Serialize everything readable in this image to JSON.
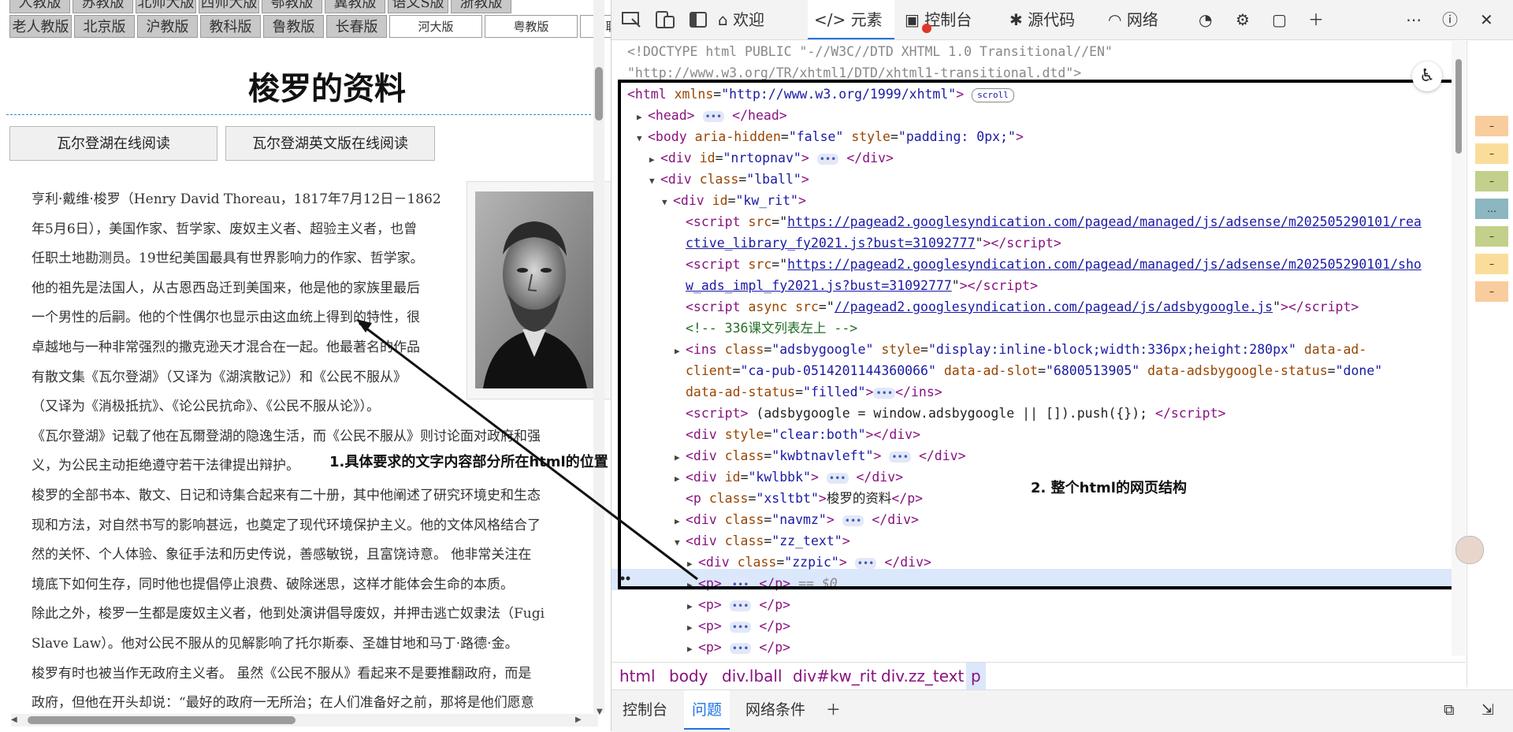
{
  "left_page": {
    "nav_row1": [
      "人教版",
      "苏教版",
      "北师大版",
      "西师大版",
      "鄂教版",
      "冀教版",
      "语文S版",
      "浙教版"
    ],
    "nav_row2": [
      "老人教版",
      "北京版",
      "沪教版",
      "教科版",
      "鲁教版",
      "长春版"
    ],
    "nav_row2_white": [
      "河大版",
      "粤教版",
      "中职版"
    ],
    "title": "梭罗的资料",
    "read_buttons": [
      "瓦尔登湖在线阅读",
      "瓦尔登湖英文版在线阅读"
    ],
    "article_lines": [
      "亨利·戴维·梭罗（Henry David Thoreau，1817年7月12日－1862",
      "年5月6日），美国作家、哲学家、废奴主义者、超验主义者，也曾",
      "任职土地勘测员。19世纪美国最具有世界影响力的作家、哲学家。",
      "他的祖先是法国人，从古恩西岛迁到美国来，他是他的家族里最后",
      "一个男性的后嗣。他的个性偶尔也显示由这血统上得到的特性，很",
      "卓越地与一种非常强烈的撒克逊天才混合在一起。他最著名的作品",
      "有散文集《瓦尔登湖》（又译为《湖滨散记》）和《公民不服从》",
      "（又译为《消极抵抗》、《论公民抗命》、《公民不服从论》）。",
      "《瓦尔登湖》记载了他在瓦爾登湖的隐逸生活，而《公民不服从》则讨论面对政府和强",
      "义，为公民主动拒绝遵守若干法律提出辩护。",
      "梭罗的全部书本、散文、日记和诗集合起来有二十册，其中他阐述了研究环境史和生态",
      "现和方法，对自然书写的影响甚远，也奠定了现代环境保护主义。他的文体风格结合了",
      "然的关怀、个人体验、象征手法和历史传说，善感敏锐，且富饶诗意。  他非常关注在",
      "境底下如何生存，同时他也提倡停止浪费、破除迷思，这样才能体会生命的本质。",
      "除此之外，梭罗一生都是废奴主义者，他到处演讲倡导废奴，并押击逃亡奴隶法（Fugi",
      "Slave Law）。他对公民不服从的见解影响了托尔斯泰、圣雄甘地和马丁·路德·金。",
      "梭罗有时也被当作无政府主义者。 虽然《公民不服从》看起来不是要推翻政府，而是",
      "政府，但他在开头却说：“最好的政府一无所治；在人们准备好之前，那将是他们愿意"
    ]
  },
  "annotations": {
    "a1": "1.具体要求的文字内容部分所在html的位置",
    "a2": "2. 整个html的网页结构"
  },
  "devtools": {
    "tabs": {
      "welcome": "欢迎",
      "elements": "元素",
      "console": "控制台",
      "sources": "源代码",
      "network": "网络"
    },
    "dom": {
      "doctype1": "<!DOCTYPE html PUBLIC \"-//W3C//DTD XHTML 1.0 Transitional//EN\"",
      "doctype2": "\"http://www.w3.org/TR/xhtml1/DTD/xhtml1-transitional.dtd\">",
      "html_attr_val": "\"http://www.w3.org/1999/xhtml\"",
      "scroll_badge": "scroll",
      "url1a": "https://pagead2.googlesyndication.com/pagead/managed/js/adsense/m202505290101/rea",
      "url1b": "ctive_library_fy2021.js?bust=31092777",
      "url2a": "https://pagead2.googlesyndication.com/pagead/managed/js/adsense/m202505290101/sho",
      "url2b": "w_ads_impl_fy2021.js?bust=31092777",
      "url3": "//pagead2.googlesyndication.com/pagead/js/adsbygoogle.js",
      "comment": "<!-- 336课文列表左上 -->",
      "ins_style": "\"display:inline-block;width:336px;height:280px\"",
      "ins_client": "\"ca-pub-0514201144360066\"",
      "ins_slot": "\"6800513905\"",
      "ins_status": "\"done\"",
      "ad_status": "\"filled\"",
      "push_script": " (adsbygoogle = window.adsbygoogle || []).push({}); ",
      "p_text": "梭罗的资料",
      "eq0": "== $0"
    },
    "breadcrumbs": [
      "html",
      "body",
      "div.lball",
      "div#kw_rit",
      "div.zz_text",
      "p"
    ],
    "drawer_tabs": [
      "控制台",
      "问题",
      "网络条件"
    ]
  }
}
